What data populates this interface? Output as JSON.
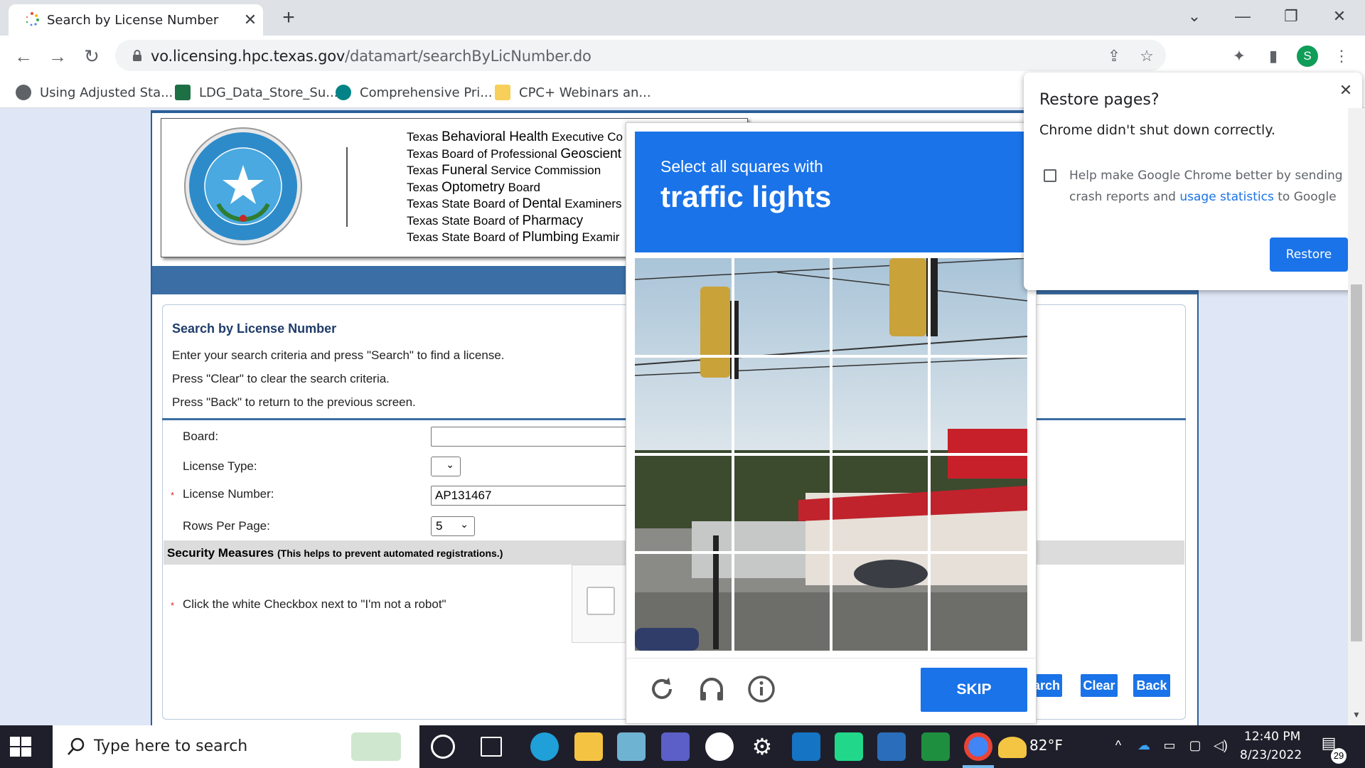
{
  "browser": {
    "tab_title": "Search by License Number",
    "tab_close": "✕",
    "new_tab": "+",
    "window_controls": [
      "⌄",
      "—",
      "❐",
      "✕"
    ],
    "url_host": "vo.licensing.hpc.texas.gov",
    "url_path": "/datamart/searchByLicNumber.do",
    "avatar_letter": "S",
    "bookmarks": [
      {
        "label": "Using Adjusted Sta...",
        "icon": "globe-icon"
      },
      {
        "label": "LDG_Data_Store_Su...",
        "icon": "excel-icon"
      },
      {
        "label": "Comprehensive Pri...",
        "icon": "sharepoint-icon"
      },
      {
        "label": "CPC+ Webinars an...",
        "icon": "folder-icon"
      }
    ]
  },
  "banner": {
    "seal_text": "THE STATE OF TEXAS",
    "boards": [
      {
        "pre": "Texas ",
        "big": "Behavioral Health",
        "post": " Executive Co"
      },
      {
        "pre": "Texas Board of Professional ",
        "big": "Geoscient",
        "post": ""
      },
      {
        "pre": "Texas ",
        "big": "Funeral",
        "post": " Service Commission"
      },
      {
        "pre": "Texas ",
        "big": "Optometry",
        "post": " Board"
      },
      {
        "pre": "Texas State Board of ",
        "big": "Dental",
        "post": " Examiners"
      },
      {
        "pre": "Texas State Board of ",
        "big": "Pharmacy",
        "post": ""
      },
      {
        "pre": "Texas State Board of ",
        "big": "Plumbing",
        "post": " Examir"
      }
    ]
  },
  "search": {
    "title": "Search by License Number",
    "instructions": [
      "Enter your search criteria and press \"Search\" to find a license.",
      "Press \"Clear\" to clear the search criteria.",
      "Press \"Back\" to return to the previous screen."
    ],
    "fields": {
      "board_label": "Board:",
      "board_value": "",
      "license_type_label": "License Type:",
      "license_type_value": "",
      "license_number_label": "License Number:",
      "license_number_value": "AP131467",
      "rows_per_page_label": "Rows Per Page:",
      "rows_per_page_value": "5"
    },
    "required_mark": "*",
    "security_title": "Security Measures",
    "security_note": "(This helps to prevent automated registrations.)",
    "robot_instruction": "Click the white Checkbox next to \"I'm not a robot\"",
    "buttons": {
      "search": "arch",
      "clear": "Clear",
      "back": "Back"
    }
  },
  "captcha": {
    "prompt_line1": "Select all squares with",
    "prompt_target": "traffic lights",
    "skip_label": "SKIP",
    "icons": [
      "reload-icon",
      "audio-icon",
      "info-icon"
    ]
  },
  "restore_popup": {
    "title": "Restore pages?",
    "subtitle": "Chrome didn't shut down correctly.",
    "help_pre": "Help make Google Chrome better by sending crash reports and ",
    "help_link": "usage statistics",
    "help_post": " to Google",
    "button": "Restore",
    "close": "✕"
  },
  "taskbar": {
    "search_placeholder": "Type here to search",
    "weather": "82°F",
    "time": "12:40 PM",
    "date": "8/23/2022",
    "notifications": "29"
  },
  "colors": {
    "accent": "#1a73e8",
    "frame_blue": "#2d5f9a",
    "section_title": "#1f3c6a"
  }
}
